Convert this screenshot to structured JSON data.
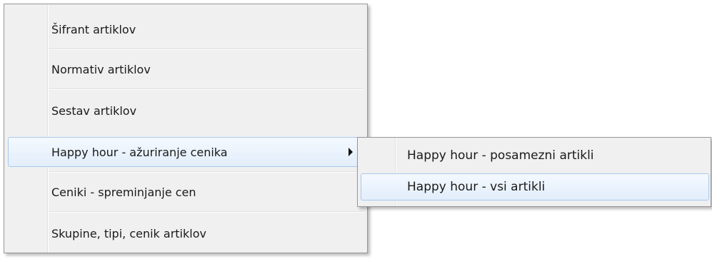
{
  "menu": {
    "items": [
      {
        "label": "Šifrant artiklov"
      },
      {
        "label": "Normativ artiklov"
      },
      {
        "label": "Sestav artiklov"
      },
      {
        "label": "Happy hour - ažuriranje cenika",
        "has_submenu": true,
        "active": true
      },
      {
        "label": "Ceniki - spreminjanje cen"
      },
      {
        "label": "Skupine, tipi, cenik artiklov"
      }
    ]
  },
  "submenu": {
    "items": [
      {
        "label": "Happy hour - posamezni artikli"
      },
      {
        "label": "Happy hour - vsi artikli",
        "active": true
      }
    ]
  },
  "colors": {
    "menu_background": "#f0f0f0",
    "highlight_border": "#a8c8ec",
    "highlight_fill": "#e2eefb"
  },
  "icons": {
    "submenu_arrow": "chevron-right-icon"
  }
}
